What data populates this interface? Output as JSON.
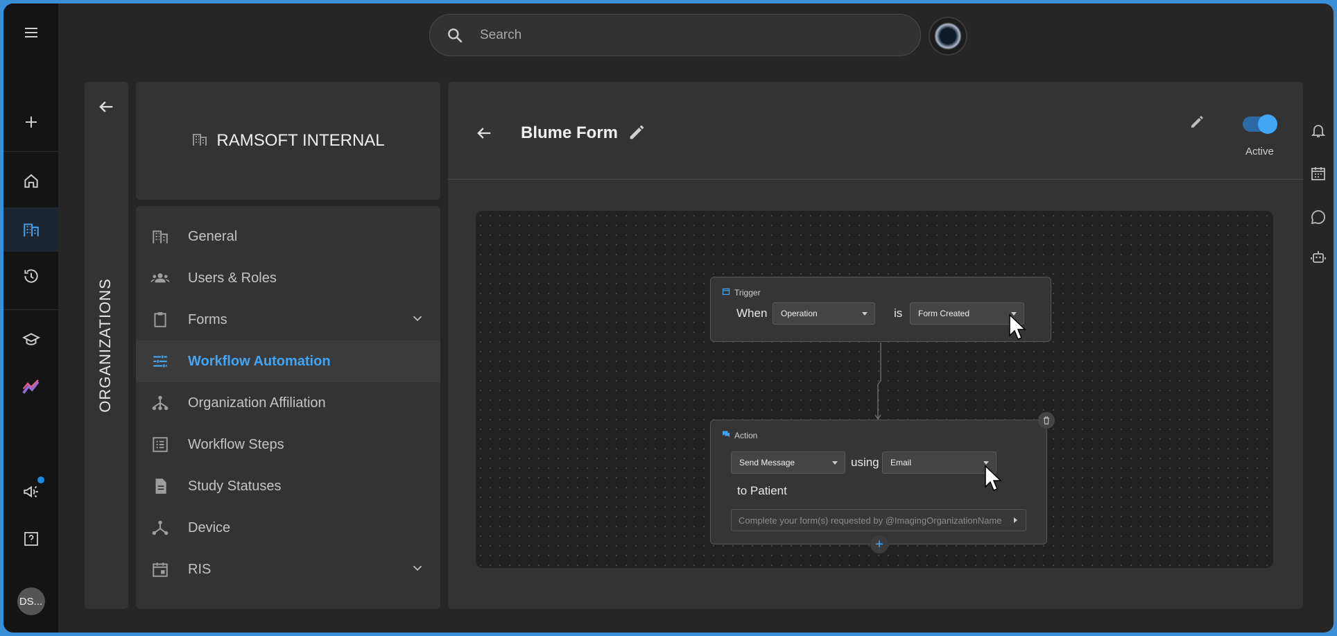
{
  "search": {
    "placeholder": "Search"
  },
  "user": {
    "initials": "DS..."
  },
  "organizations": {
    "label": "ORGANIZATIONS"
  },
  "org": {
    "name": "RAMSOFT INTERNAL"
  },
  "menu": [
    {
      "label": "General",
      "icon": "building-icon"
    },
    {
      "label": "Users & Roles",
      "icon": "people-icon"
    },
    {
      "label": "Forms",
      "icon": "clipboard-icon"
    },
    {
      "label": "Workflow Automation",
      "icon": "tune-icon"
    },
    {
      "label": "Organization Affiliation",
      "icon": "hierarchy-icon"
    },
    {
      "label": "Workflow Steps",
      "icon": "list-icon"
    },
    {
      "label": "Study Statuses",
      "icon": "document-icon"
    },
    {
      "label": "Device",
      "icon": "device-hub-icon"
    },
    {
      "label": "RIS",
      "icon": "calendar-icon"
    }
  ],
  "main": {
    "title": "Blume Form",
    "active_label": "Active",
    "active": true
  },
  "trigger": {
    "header": "Trigger",
    "when": "When",
    "field": "Operation",
    "is": "is",
    "value": "Form Created"
  },
  "action": {
    "header": "Action",
    "action_value": "Send Message",
    "using": "using",
    "channel": "Email",
    "to": "to Patient",
    "message": "Complete your form(s) requested by @ImagingOrganizationName"
  },
  "colors": {
    "accent": "#42a5f5",
    "background": "#262626",
    "panel": "#333333",
    "rail": "#141414"
  }
}
